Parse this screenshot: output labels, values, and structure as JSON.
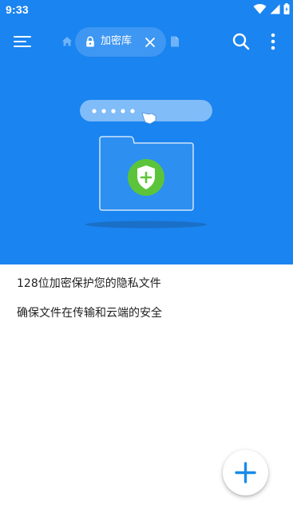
{
  "status_bar": {
    "time": "9:33"
  },
  "app_bar": {
    "tab_label": "加密库"
  },
  "content": {
    "line1": "128位加密保护您的隐私文件",
    "line2": "确保文件在传输和云端的安全"
  },
  "colors": {
    "primary": "#1a84f0",
    "accent": "#1a8be8",
    "shield": "#5cc43a"
  },
  "icons": {
    "menu": "hamburger-menu-icon",
    "home": "home-icon",
    "lock": "lock-icon",
    "close": "close-icon",
    "file": "file-icon",
    "search": "search-icon",
    "more": "more-vertical-icon",
    "add": "add-icon"
  }
}
